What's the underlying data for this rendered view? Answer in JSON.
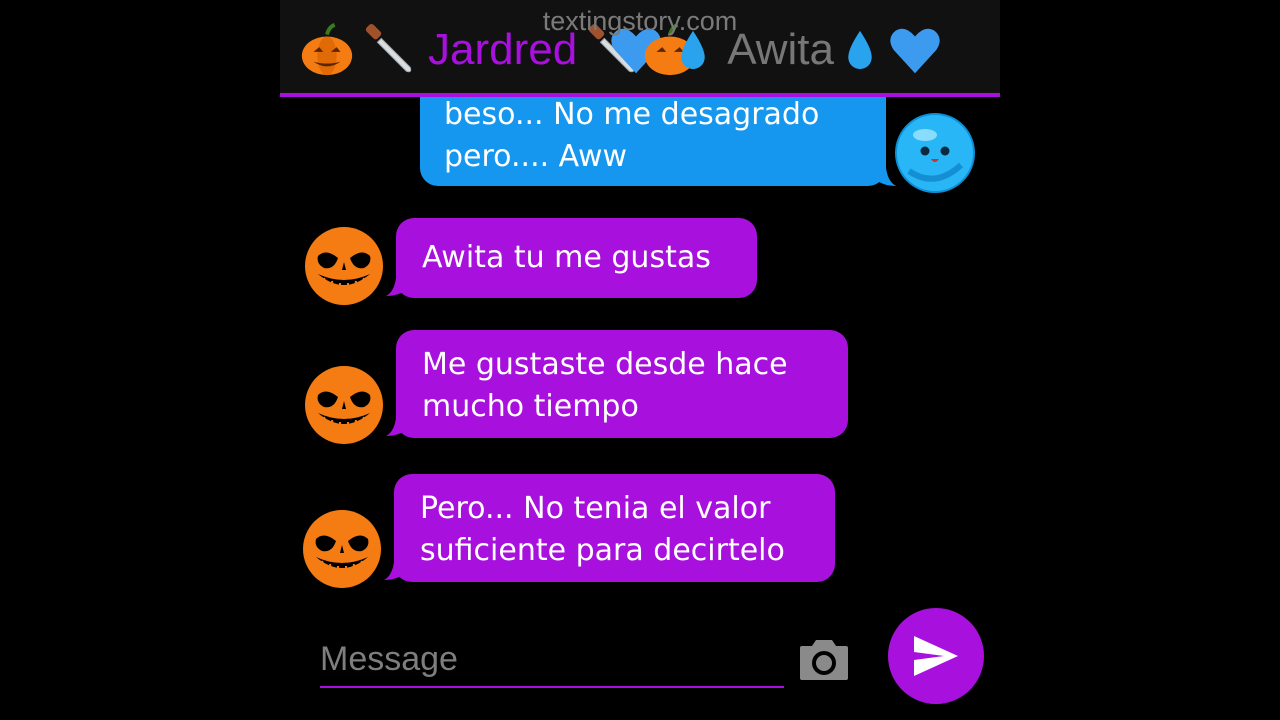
{
  "watermark": "textingstory.com",
  "header": {
    "contact_name": "Jardred",
    "my_name": "Awita",
    "left_emojis": [
      "pumpkin-icon",
      "knife-icon",
      "blue-heart-icon",
      "pumpkin-icon",
      "droplet-icon"
    ],
    "right_emojis": [
      "droplet-icon",
      "blue-heart-icon"
    ]
  },
  "messages": [
    {
      "sender": "me",
      "text": "beso... No me desagrado\npero.... Aww"
    },
    {
      "sender": "them",
      "text": "Awita tu me gustas"
    },
    {
      "sender": "them",
      "text": "Me gustaste desde hace\nmucho tiempo"
    },
    {
      "sender": "them",
      "text": "Pero... No tenia el valor\nsuficiente para decirtelo"
    }
  ],
  "composer": {
    "placeholder": "Message",
    "camera_icon": "camera-icon",
    "send_icon": "send-icon"
  },
  "colors": {
    "accent": "#a811dd",
    "my_bubble": "#1597ef",
    "their_avatar": "#f57c12",
    "my_avatar": "#28b6f6",
    "header_bg": "#111111"
  }
}
